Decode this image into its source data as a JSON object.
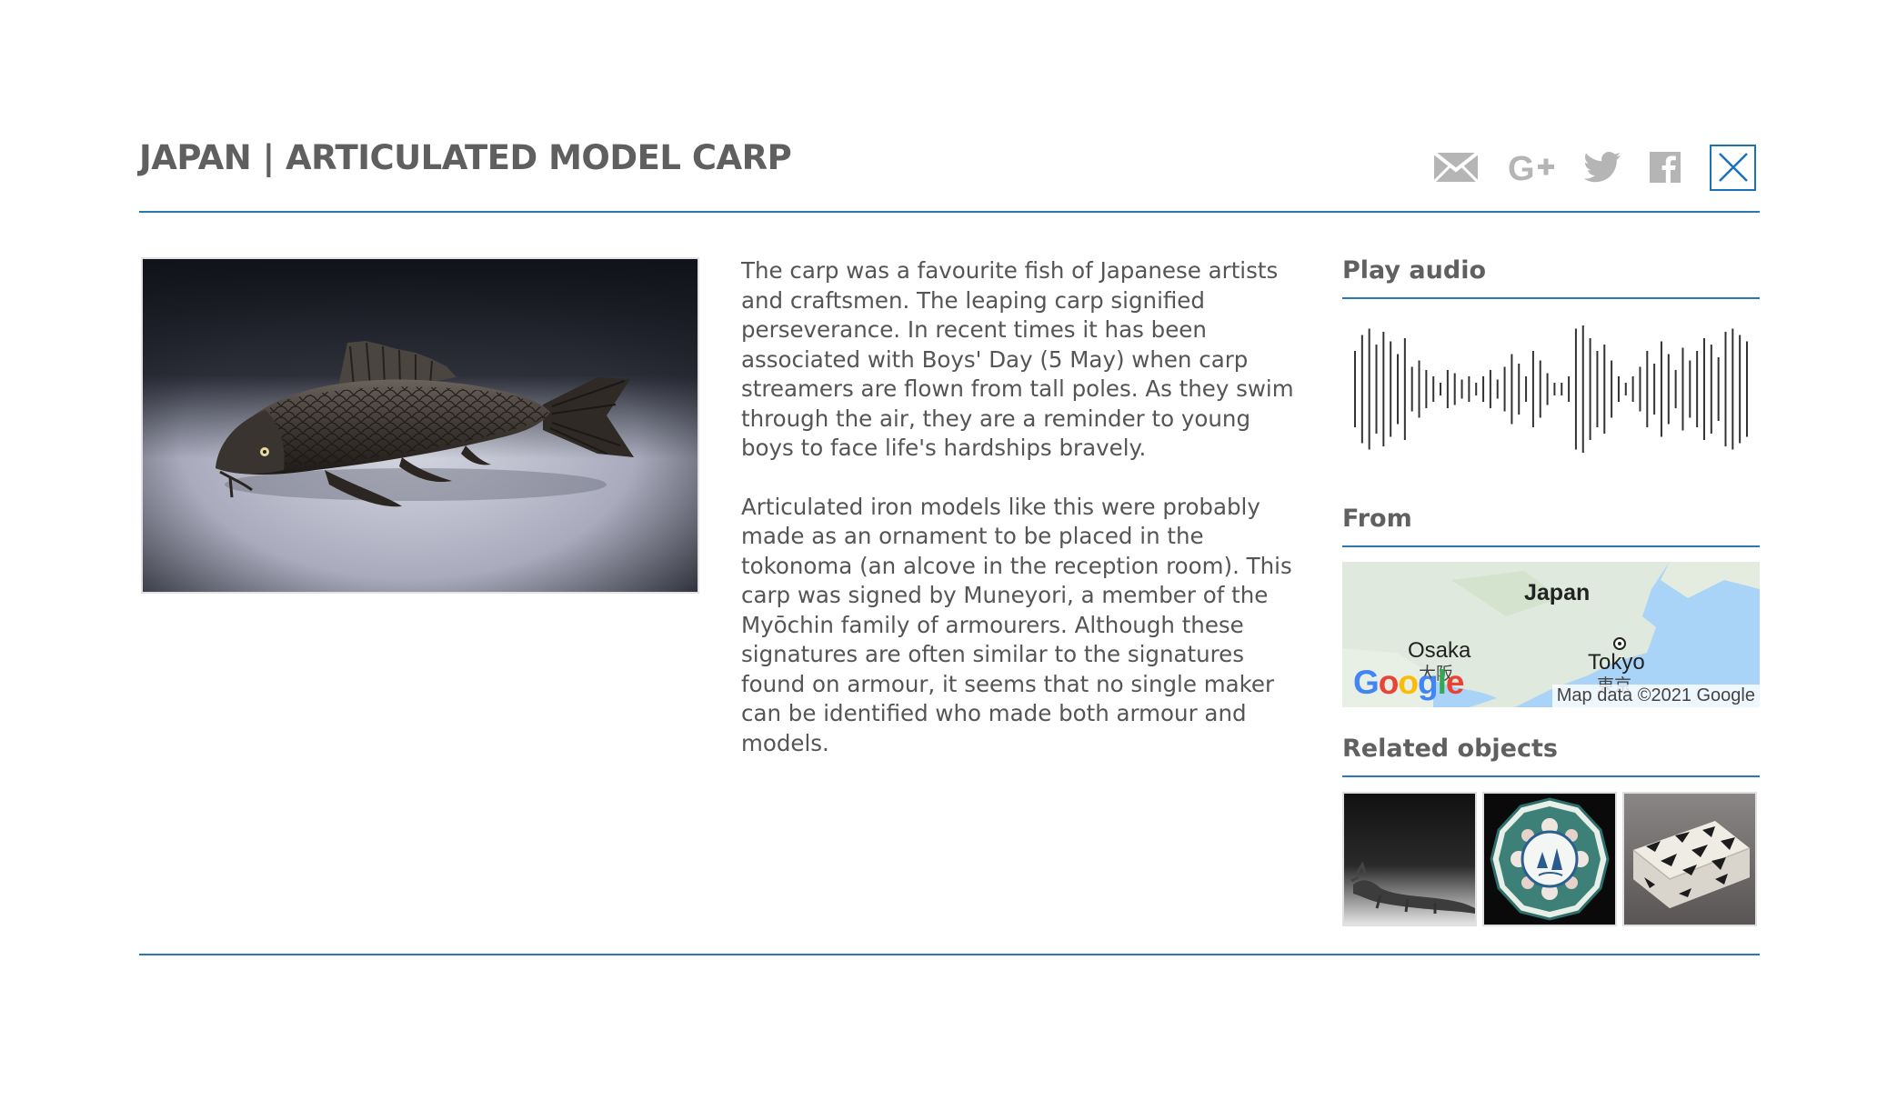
{
  "header": {
    "title": "JAPAN | ARTICULATED MODEL CARP",
    "share_icons": [
      "email-icon",
      "google-plus-icon",
      "twitter-icon",
      "facebook-icon"
    ],
    "close_icon": "close-icon"
  },
  "description": {
    "paragraphs": [
      "The carp was a favourite fish of Japanese artists and craftsmen. The leaping carp signified perseverance. In recent times it has been associated with Boys' Day (5 May) when carp streamers are flown from tall poles. As they swim through the air, they are a reminder to young boys to face life's hardships bravely.",
      "Articulated iron models like this were probably made as an ornament to be placed in the tokonoma (an alcove in the reception room). This carp was signed by Muneyori, a member of the Myōchin family of armourers. Although these signatures are often similar to the signatures found on armour, it seems that no single maker can be identified who made both armour and models."
    ]
  },
  "sidebar": {
    "audio_heading": "Play audio",
    "from_heading": "From",
    "related_heading": "Related objects",
    "map": {
      "country_label": "Japan",
      "city_1": "Osaka",
      "city_1_native": "大阪",
      "city_2": "Tokyo",
      "city_2_native": "東京",
      "logo_letters": [
        "G",
        "o",
        "o",
        "g",
        "l",
        "e"
      ],
      "attribution": "Map data ©2021 Google"
    },
    "related": [
      "dragon-figure-thumbnail",
      "porcelain-dish-thumbnail",
      "lacquer-box-thumbnail"
    ]
  },
  "colors": {
    "accent": "#2a79b5",
    "title": "#5f5f5f",
    "body_text": "#555555",
    "icon_gray": "#b5b5b5"
  }
}
